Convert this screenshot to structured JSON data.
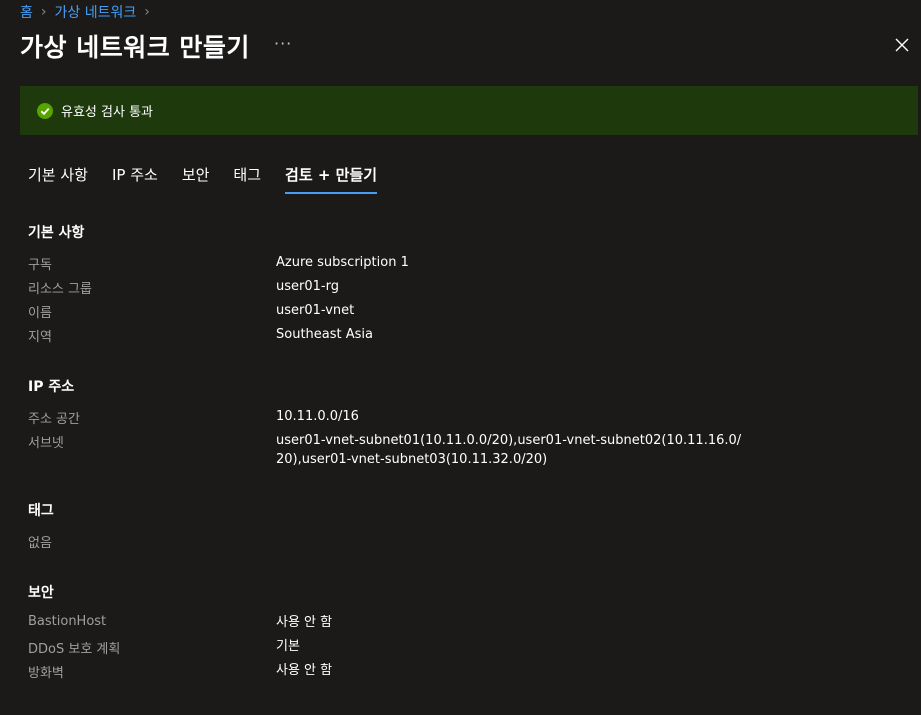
{
  "breadcrumb": {
    "home": "홈",
    "current": "가상 네트워크",
    "separator": "›"
  },
  "title": "가상 네트워크 만들기",
  "more_label": "···",
  "banner": {
    "message": "유효성 검사 통과",
    "color": "#1e3a0c"
  },
  "tabs": [
    {
      "label": "기본 사항",
      "active": false
    },
    {
      "label": "IP 주소",
      "active": false
    },
    {
      "label": "보안",
      "active": false
    },
    {
      "label": "태그",
      "active": false
    },
    {
      "label": "검토 + 만들기",
      "active": true
    }
  ],
  "sections": {
    "basics": {
      "title": "기본 사항",
      "rows": [
        {
          "label": "구독",
          "value": "Azure subscription 1"
        },
        {
          "label": "리소스 그룹",
          "value": "user01-rg"
        },
        {
          "label": "이름",
          "value": "user01-vnet"
        },
        {
          "label": "지역",
          "value": "Southeast Asia"
        }
      ]
    },
    "ip": {
      "title": "IP 주소",
      "rows": [
        {
          "label": "주소 공간",
          "value": "10.11.0.0/16"
        },
        {
          "label": "서브넷",
          "value": "user01-vnet-subnet01(10.11.0.0/20),user01-vnet-subnet02(10.11.16.0/20),user01-vnet-subnet03(10.11.32.0/20)"
        }
      ]
    },
    "tags": {
      "title": "태그",
      "empty": "없음"
    },
    "security": {
      "title": "보안",
      "rows": [
        {
          "label": "BastionHost",
          "value": "사용 안 함"
        },
        {
          "label": "DDoS 보호 계획",
          "value": "기본"
        },
        {
          "label": "방화벽",
          "value": "사용 안 함"
        }
      ]
    }
  },
  "colors": {
    "accent": "#479ef5",
    "background": "#1b1a19",
    "success": "#57a300"
  }
}
